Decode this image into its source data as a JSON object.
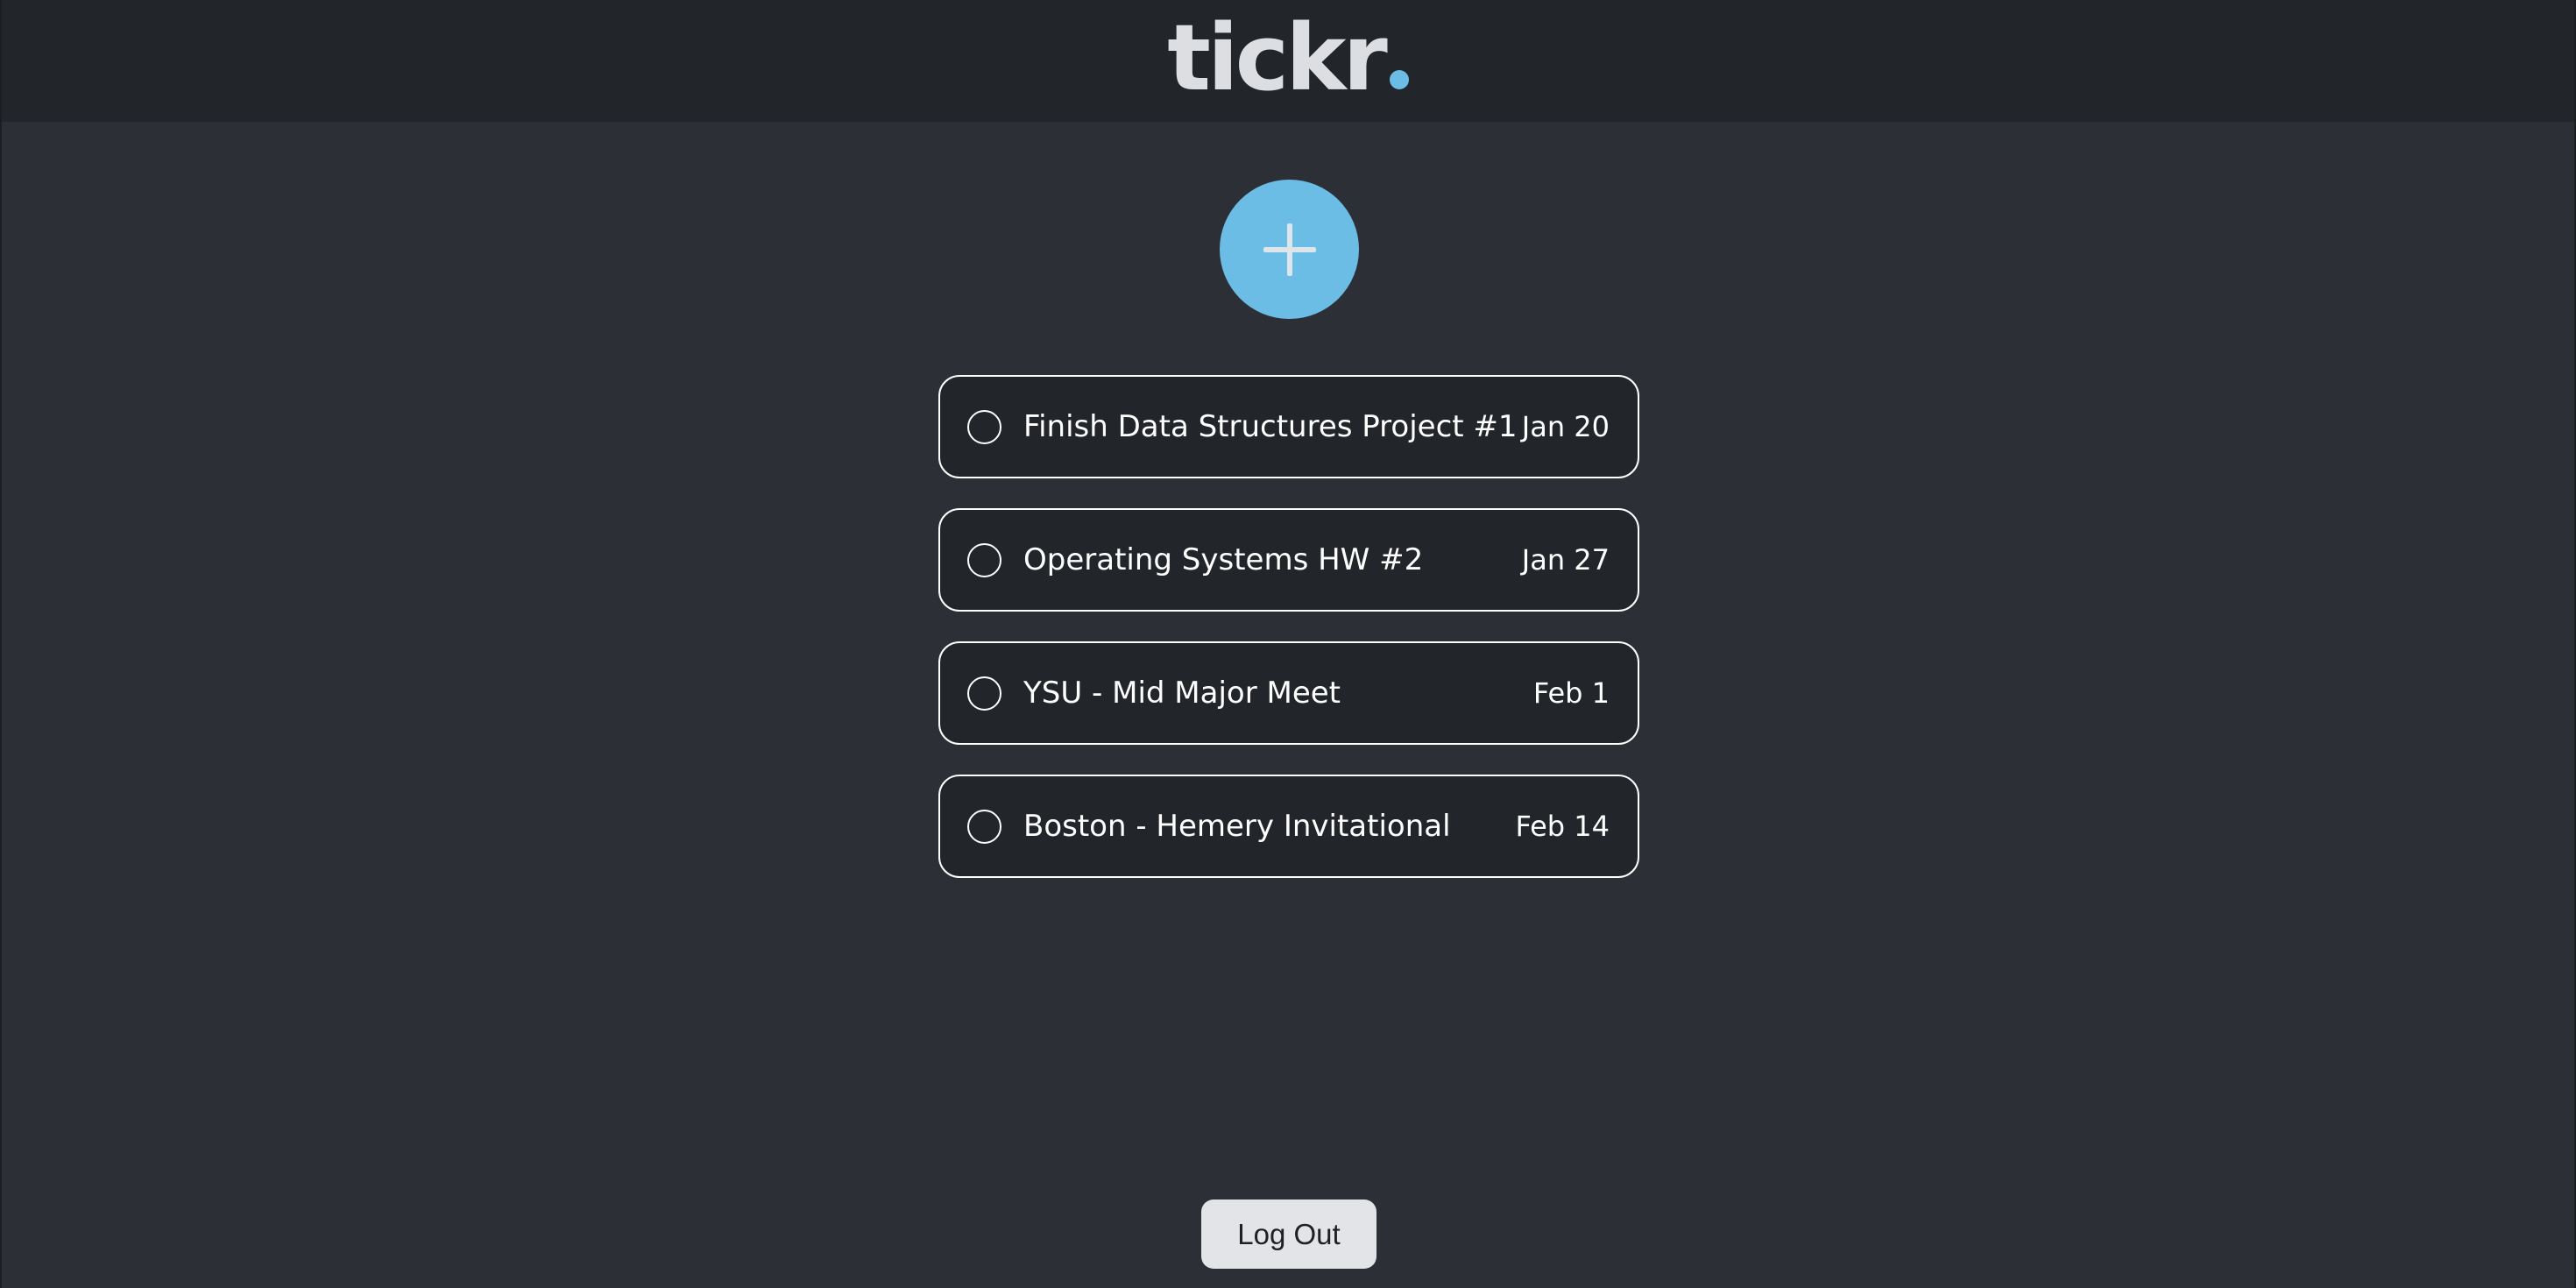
{
  "header": {
    "logo_text": "tickr",
    "logo_dot_icon": "accent-dot-icon"
  },
  "colors": {
    "accent": "#6bbde6",
    "background": "#2c2f35",
    "header_background": "#22252a",
    "card_background": "#22252a",
    "card_border": "#ffffff",
    "logout_background": "#e2e4e8"
  },
  "add_button": {
    "icon": "plus-icon"
  },
  "tasks": [
    {
      "title": "Finish Data Structures Project #1",
      "date": "Jan 20",
      "completed": false
    },
    {
      "title": "Operating Systems HW #2",
      "date": "Jan 27",
      "completed": false
    },
    {
      "title": "YSU - Mid Major Meet",
      "date": "Feb 1",
      "completed": false
    },
    {
      "title": "Boston - Hemery Invitational",
      "date": "Feb 14",
      "completed": false
    }
  ],
  "logout": {
    "label": "Log Out"
  }
}
